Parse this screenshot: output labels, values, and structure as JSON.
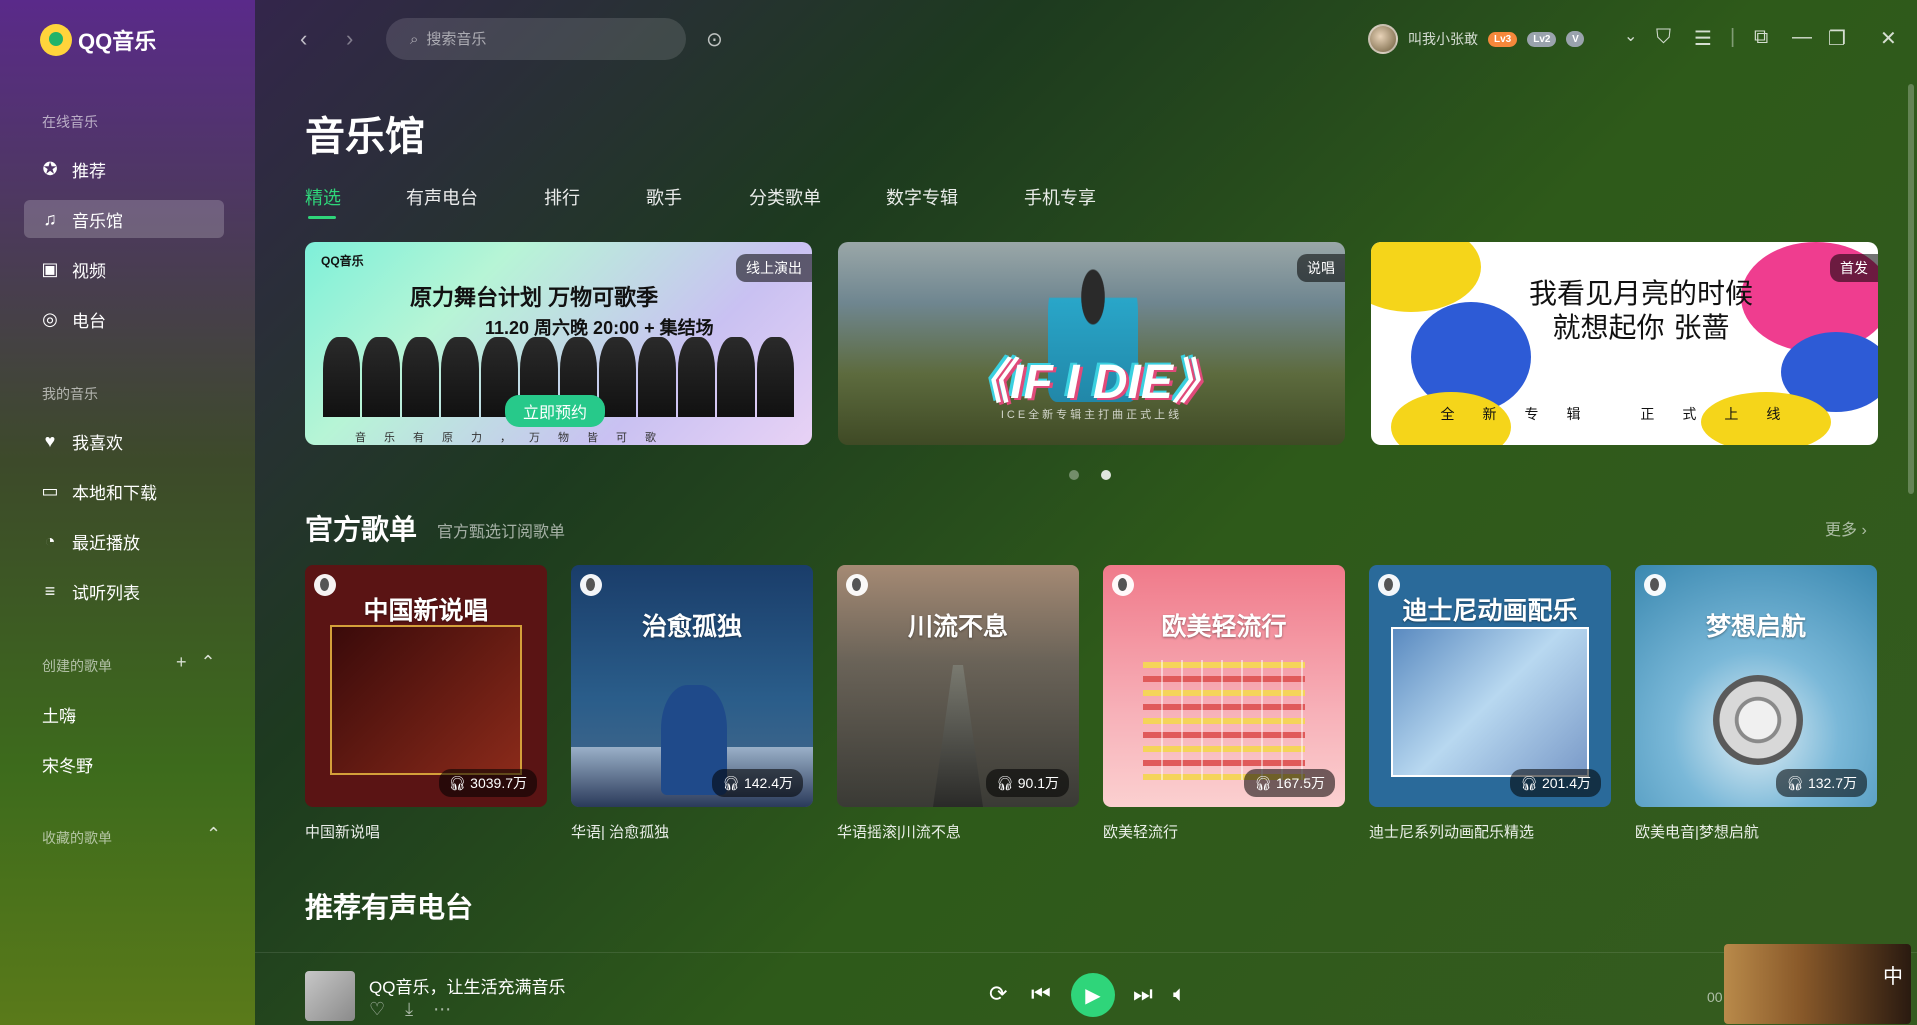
{
  "app": {
    "logo_text": "QQ音乐"
  },
  "sidebar": {
    "online_section": "在线音乐",
    "online_items": [
      {
        "label": "推荐",
        "icon": "star-icon"
      },
      {
        "label": "音乐馆",
        "icon": "music-note-icon"
      },
      {
        "label": "视频",
        "icon": "video-icon"
      },
      {
        "label": "电台",
        "icon": "radio-icon"
      }
    ],
    "my_section": "我的音乐",
    "my_items": [
      {
        "label": "我喜欢",
        "icon": "heart-icon"
      },
      {
        "label": "本地和下载",
        "icon": "monitor-icon"
      },
      {
        "label": "最近播放",
        "icon": "clock-icon"
      },
      {
        "label": "试听列表",
        "icon": "playlist-icon"
      }
    ],
    "created_section": "创建的歌单",
    "created_items": [
      "土嗨",
      "宋冬野"
    ],
    "collected_section": "收藏的歌单"
  },
  "topbar": {
    "search_placeholder": "搜索音乐",
    "username": "叫我小张敢",
    "badge_lv3": "Lv3",
    "badge_lv2": "Lv2",
    "badge_v": "V"
  },
  "page": {
    "title": "音乐馆"
  },
  "tabs": [
    "精选",
    "有声电台",
    "排行",
    "歌手",
    "分类歌单",
    "数字专辑",
    "手机专享"
  ],
  "banners": [
    {
      "tag": "线上演出",
      "brand": "QQ音乐",
      "title": "原力舞台计划 万物可歌季",
      "date": "11.20 周六晚 20:00 + 集结场",
      "button": "立即预约",
      "sub": "音乐有原力，万物皆可歌"
    },
    {
      "tag": "说唱",
      "title": "《IF I DIE》",
      "sub": "ICE全新专辑主打曲正式上线"
    },
    {
      "tag": "首发",
      "title": "我看见月亮的时候 就想起你 张蔷",
      "sub": "全新专辑 正式上线"
    }
  ],
  "official": {
    "title": "官方歌单",
    "subtitle": "官方甄选订阅歌单",
    "more": "更多",
    "cards": [
      {
        "cover_title": "中国新说唱",
        "plays": "3039.7万",
        "name": "中国新说唱",
        "bg": "#6a1a1a"
      },
      {
        "cover_title": "治愈孤独",
        "plays": "142.4万",
        "name": "华语| 治愈孤独",
        "bg": "#1e4f7a"
      },
      {
        "cover_title": "川流不息",
        "plays": "90.1万",
        "name": "华语摇滚|川流不息",
        "bg": "#6a6358"
      },
      {
        "cover_title": "欧美轻流行",
        "plays": "167.5万",
        "name": "欧美轻流行",
        "bg": "#f3a3b0"
      },
      {
        "cover_title": "迪士尼动画配乐",
        "plays": "201.4万",
        "name": "迪士尼系列动画配乐精选",
        "bg": "#2a6a9a"
      },
      {
        "cover_title": "梦想启航",
        "plays": "132.7万",
        "name": "欧美电音|梦想启航",
        "bg": "#4a9ac0"
      }
    ]
  },
  "radio_section": {
    "title": "推荐有声电台"
  },
  "player": {
    "title": "QQ音乐，让生活充满音乐",
    "time": "00"
  },
  "widget": {
    "text": "中"
  }
}
